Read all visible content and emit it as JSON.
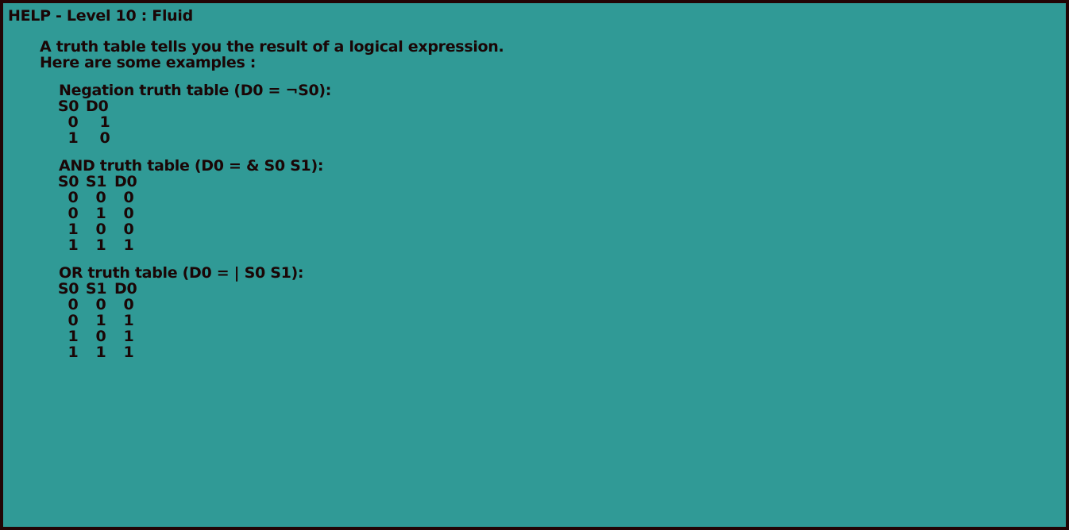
{
  "window": {
    "title": "HELP - Level 10 : Fluid"
  },
  "intro": {
    "line1": "A truth table tells you the result of a logical expression.",
    "line2": "Here are some examples :"
  },
  "tables": [
    {
      "title": "Negation truth table (D0 = ¬S0):",
      "headers": [
        "S0",
        "D0"
      ],
      "rows": [
        [
          "0",
          "1"
        ],
        [
          "1",
          "0"
        ]
      ]
    },
    {
      "title": "AND truth table (D0 = & S0 S1):",
      "headers": [
        "S0",
        "S1",
        "D0"
      ],
      "rows": [
        [
          "0",
          "0",
          "0"
        ],
        [
          "0",
          "1",
          "0"
        ],
        [
          "1",
          "0",
          "0"
        ],
        [
          "1",
          "1",
          "1"
        ]
      ]
    },
    {
      "title": "OR truth table (D0 = | S0 S1):",
      "headers": [
        "S0",
        "S1",
        "D0"
      ],
      "rows": [
        [
          "0",
          "0",
          "0"
        ],
        [
          "0",
          "1",
          "1"
        ],
        [
          "1",
          "0",
          "1"
        ],
        [
          "1",
          "1",
          "1"
        ]
      ]
    }
  ],
  "colors": {
    "background": "#309a96",
    "border": "#220505",
    "text": "#1a0606"
  }
}
